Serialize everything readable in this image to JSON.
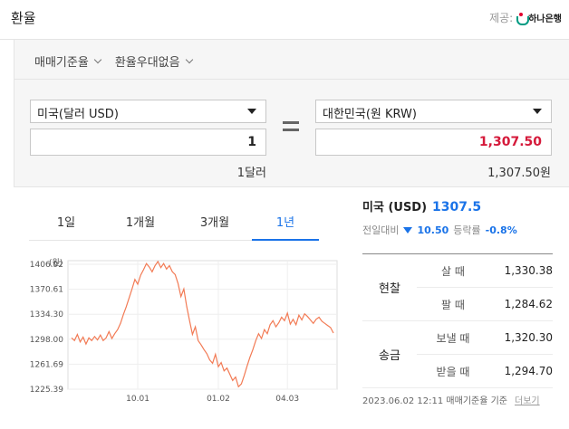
{
  "header": {
    "title": "환율",
    "provider_label": "제공:",
    "provider_name": "하나은행"
  },
  "filters": [
    {
      "label": "매매기준율"
    },
    {
      "label": "환율우대없음"
    }
  ],
  "converter": {
    "from_currency": "미국(달러 USD)",
    "from_amount": "1",
    "from_unit": "1달러",
    "to_currency": "대한민국(원 KRW)",
    "to_amount": "1,307.50",
    "to_unit": "1,307.50원"
  },
  "tabs": [
    {
      "label": "1일"
    },
    {
      "label": "1개월"
    },
    {
      "label": "3개월"
    },
    {
      "label": "1년",
      "active": true
    }
  ],
  "chart_data": {
    "type": "line",
    "ylabel": "(원)",
    "y_ticks": [
      "1406.92",
      "1370.61",
      "1334.30",
      "1298.00",
      "1261.69",
      "1225.39"
    ],
    "x_ticks": [
      "10.01",
      "01.02",
      "04.03"
    ],
    "ylim": [
      1225.39,
      1406.92
    ],
    "grid": true,
    "color": "#f27a54",
    "series": [
      {
        "values": [
          1300,
          1296,
          1305,
          1294,
          1301,
          1291,
          1300,
          1296,
          1302,
          1297,
          1304,
          1296,
          1300,
          1309,
          1299,
          1306,
          1312,
          1321,
          1334,
          1345,
          1358,
          1371,
          1385,
          1378,
          1391,
          1399,
          1408,
          1403,
          1396,
          1405,
          1411,
          1402,
          1408,
          1400,
          1405,
          1396,
          1392,
          1379,
          1360,
          1371,
          1346,
          1325,
          1305,
          1316,
          1296,
          1290,
          1283,
          1277,
          1268,
          1263,
          1276,
          1258,
          1264,
          1252,
          1256,
          1247,
          1238,
          1243,
          1229,
          1233,
          1245,
          1259,
          1272,
          1283,
          1296,
          1306,
          1299,
          1312,
          1306,
          1319,
          1325,
          1316,
          1322,
          1330,
          1325,
          1336,
          1320,
          1327,
          1319,
          1333,
          1326,
          1335,
          1331,
          1326,
          1321,
          1327,
          1330,
          1324,
          1321,
          1318,
          1315,
          1307
        ]
      }
    ]
  },
  "info": {
    "country": "미국 (USD)",
    "rate": "1307.5",
    "prev_label": "전일대비",
    "change": "10.50",
    "pct_label": "등락률",
    "pct": "-0.8%"
  },
  "rates": [
    {
      "group": "현찰",
      "rows": [
        {
          "label": "살 때",
          "value": "1,330.38"
        },
        {
          "label": "팔 때",
          "value": "1,284.62"
        }
      ]
    },
    {
      "group": "송금",
      "rows": [
        {
          "label": "보낼 때",
          "value": "1,320.30"
        },
        {
          "label": "받을 때",
          "value": "1,294.70"
        }
      ]
    }
  ],
  "footer": {
    "timestamp": "2023.06.02 12:11 매매기준율 기준",
    "more": "더보기"
  }
}
